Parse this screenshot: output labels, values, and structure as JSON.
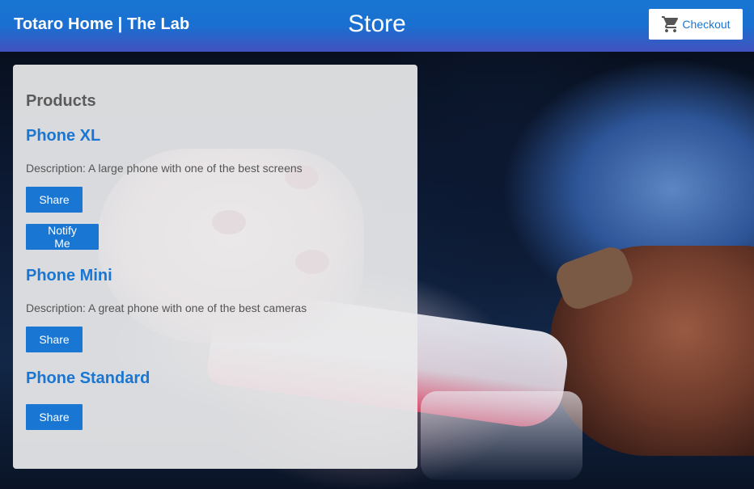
{
  "header": {
    "brand": "Totaro Home | The Lab",
    "title": "Store",
    "checkout_label": "Checkout",
    "checkout_icon": "shopping-cart-icon",
    "gradient_top": "#1877d2",
    "gradient_bottom": "#4352bf"
  },
  "products": {
    "heading": "Products",
    "items": [
      {
        "name": "Phone XL",
        "description": "Description: A large phone with one of the best screens",
        "share_label": "Share",
        "notify_label": "Notify Me"
      },
      {
        "name": "Phone Mini",
        "description": "Description: A great phone with one of the best cameras",
        "share_label": "Share"
      },
      {
        "name": "Phone Standard",
        "share_label": "Share"
      }
    ]
  },
  "colors": {
    "accent": "#1976d2",
    "card_background": "#e9eaeb"
  }
}
